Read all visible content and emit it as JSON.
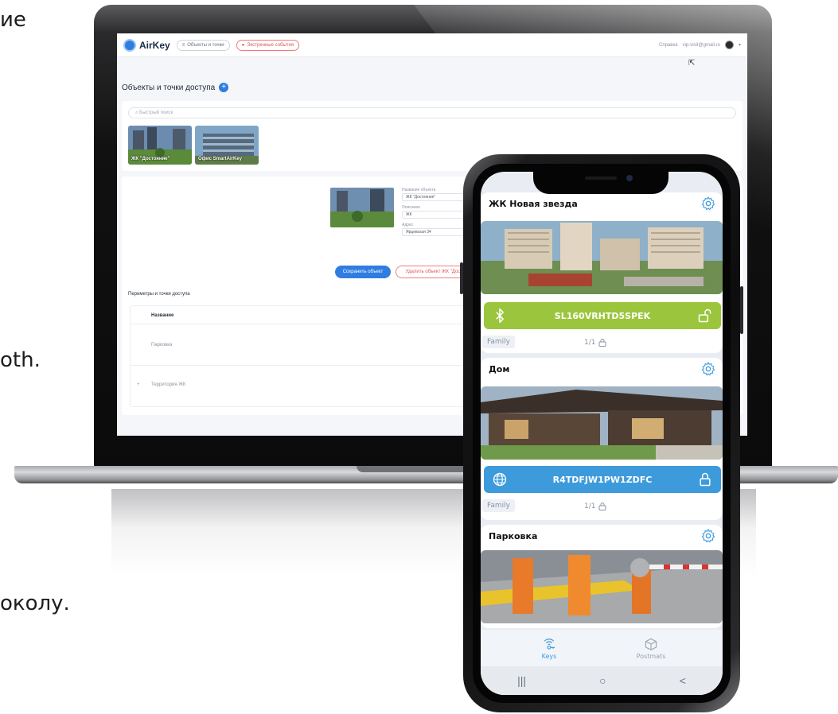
{
  "background_text": {
    "fragment_top": "ие",
    "fragment_middle": "oth.",
    "fragment_bottom": "околу."
  },
  "web_app": {
    "logo_text": "AirKey",
    "nav_objects": "Объекты и точки",
    "nav_emergency": "Экстренные события",
    "help_link": "Справка",
    "user_email": "vip-visit@gmail.ru",
    "page_title": "Объекты и точки доступа",
    "search_placeholder": "Быстрый поиск",
    "objects": [
      {
        "label": "ЖК \"Достояние\""
      },
      {
        "label": "Офис SmartAirKey"
      }
    ],
    "form": {
      "name_label": "Название объекта",
      "name_value": "ЖК \"Достояние\"",
      "desc_label": "Описание",
      "desc_value": "ЖК",
      "address_label": "Адрес",
      "address_value": "Ярцевская 34"
    },
    "save_button": "Сохранить объект",
    "delete_button": "Удалить объект ЖК \"Досто",
    "perimeters_title": "Периметры и точки доступа",
    "table_header": "Название",
    "rows": [
      {
        "name": "Парковка"
      },
      {
        "name": "Территория ЖК"
      }
    ],
    "row_expand_glyph": "+"
  },
  "mobile_app": {
    "cards": [
      {
        "title": "ЖК Новая звезда",
        "key_label": "SL160VRHTD5SPEK",
        "key_color": "#9bc53d",
        "key_left_icon": "bluetooth-icon",
        "key_right_icon": "unlocked-icon",
        "tag": "Family",
        "count": "1/1"
      },
      {
        "title": "Дом",
        "key_label": "R4TDFJW1PW1ZDFC",
        "key_color": "#3d9bdc",
        "key_left_icon": "globe-icon",
        "key_right_icon": "locked-icon",
        "tag": "Family",
        "count": "1/1"
      },
      {
        "title": "Парковка"
      }
    ],
    "tabs": [
      {
        "label": "Keys",
        "active": true,
        "color": "#3d9bdc"
      },
      {
        "label": "Postmats",
        "active": false,
        "color": "#9aa3b2"
      }
    ],
    "system_nav": [
      "|||",
      "○",
      "<"
    ]
  }
}
